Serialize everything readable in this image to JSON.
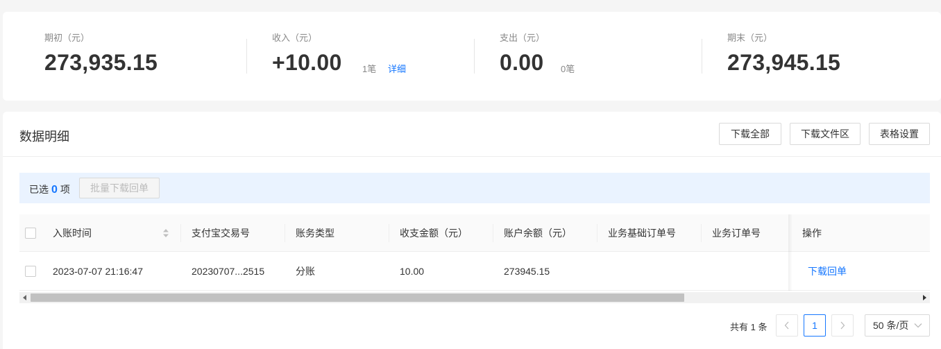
{
  "summary": {
    "opening": {
      "label": "期初（元）",
      "value": "273,935.15"
    },
    "income": {
      "label": "收入（元）",
      "value": "+10.00",
      "count": "1笔",
      "detail_link": "详细"
    },
    "expense": {
      "label": "支出（元）",
      "value": "0.00",
      "count": "0笔"
    },
    "closing": {
      "label": "期末（元）",
      "value": "273,945.15"
    }
  },
  "detail": {
    "title": "数据明细",
    "buttons": {
      "download_all": "下载全部",
      "download_files": "下载文件区",
      "table_settings": "表格设置"
    },
    "selection": {
      "prefix": "已选",
      "count": "0",
      "suffix": "项",
      "batch_button": "批量下载回单"
    }
  },
  "table": {
    "columns": [
      "入账时间",
      "支付宝交易号",
      "账务类型",
      "收支金额（元）",
      "账户余额（元）",
      "业务基础订单号",
      "业务订单号",
      "操作"
    ],
    "rows": [
      {
        "time": "2023-07-07 21:16:47",
        "trade_no": "20230707...2515",
        "type": "分账",
        "amount": "10.00",
        "balance": "273945.15",
        "base_order": "",
        "order": "",
        "action": "下载回单"
      }
    ]
  },
  "pagination": {
    "total": "共有 1 条",
    "current_page": "1",
    "page_size": "50 条/页"
  },
  "icons": {
    "sort": "sort-icon",
    "prev": "chevron-left-icon",
    "next": "chevron-right-icon",
    "dropdown": "chevron-down-icon",
    "scroll_left": "triangle-left-icon",
    "scroll_right": "triangle-right-icon"
  },
  "colors": {
    "accent": "#1677ff",
    "selection_bg": "#eaf3ff"
  }
}
